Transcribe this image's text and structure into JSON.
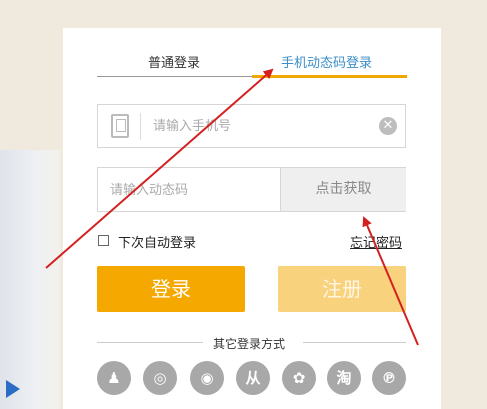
{
  "tabs": {
    "normal_label": "普通登录",
    "phone_label": "手机动态码登录"
  },
  "phone": {
    "placeholder": "请输入手机号",
    "clear_glyph": "✕"
  },
  "code": {
    "placeholder": "请输入动态码",
    "get_code_label": "点击获取"
  },
  "remember": {
    "label": "下次自动登录",
    "forgot_label": "忘记密码"
  },
  "buttons": {
    "login_label": "登录",
    "register_label": "注册"
  },
  "other": {
    "label": "其它登录方式",
    "icons": [
      "qq-icon",
      "weibo-icon",
      "wechat-icon",
      "renren-icon",
      "baidu-icon",
      "taobao-icon",
      "pinterest-icon"
    ],
    "glyphs": [
      "♟",
      "◎",
      "◉",
      "从",
      "✿",
      "淘",
      "℗"
    ]
  },
  "colors": {
    "accent": "#f4a800",
    "active_tab": "#3b8ec8",
    "arrow": "#d42020"
  }
}
